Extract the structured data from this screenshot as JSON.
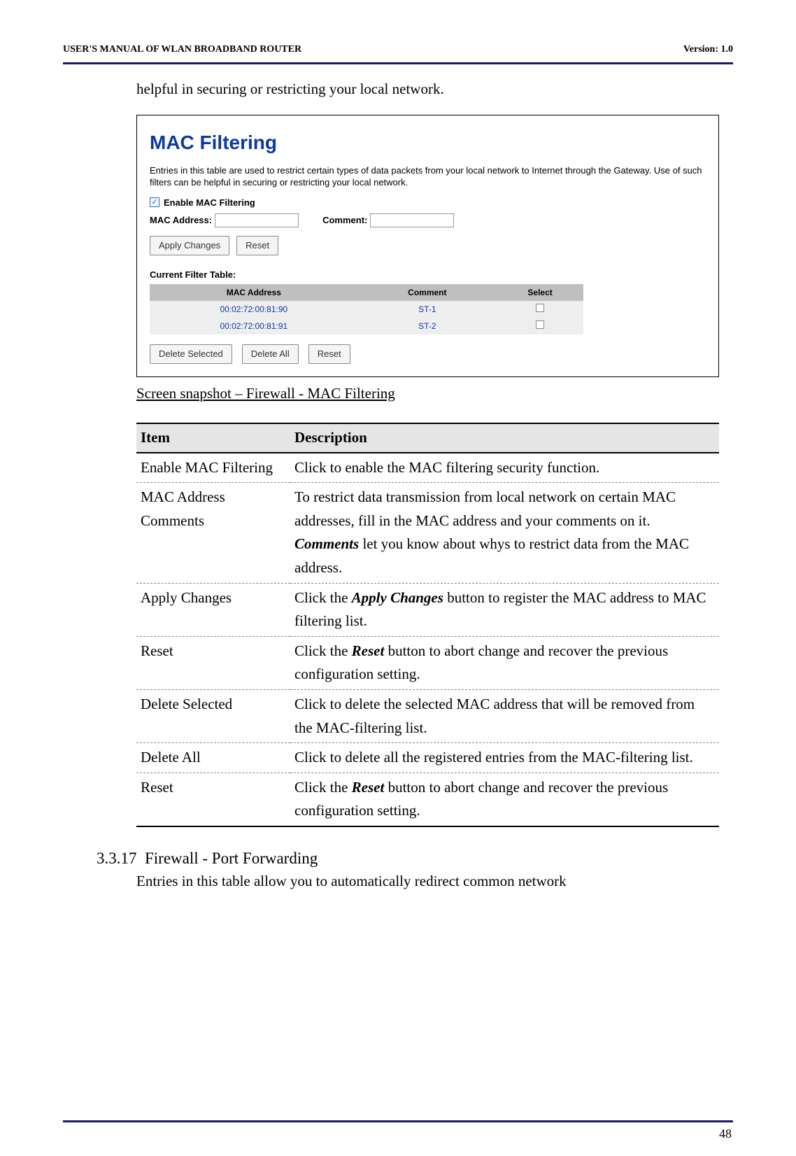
{
  "header": {
    "left": "USER'S MANUAL OF WLAN BROADBAND ROUTER",
    "right": "Version: 1.0"
  },
  "intro": "helpful in securing or restricting your local network.",
  "screenshot": {
    "title": "MAC Filtering",
    "desc": "Entries in this table are used to restrict certain types of data packets from your local network to Internet through the Gateway. Use of such filters can be helpful in securing or restricting your local network.",
    "enable_label": "Enable MAC Filtering",
    "mac_label": "MAC Address:",
    "comment_label": "Comment:",
    "apply_btn": "Apply Changes",
    "reset_btn": "Reset",
    "table_label": "Current Filter Table:",
    "th_mac": "MAC Address",
    "th_comment": "Comment",
    "th_select": "Select",
    "rows": [
      {
        "mac": "00:02:72:00:81:90",
        "comment": "ST-1"
      },
      {
        "mac": "00:02:72:00:81:91",
        "comment": "ST-2"
      }
    ],
    "del_sel_btn": "Delete Selected",
    "del_all_btn": "Delete All",
    "reset2_btn": "Reset"
  },
  "caption": "Screen snapshot – Firewall - MAC Filtering",
  "desc_table": {
    "h_item": "Item",
    "h_desc": "Description",
    "rows": {
      "r1_item": "Enable MAC Filtering",
      "r1_desc": "Click to enable the MAC filtering security function.",
      "r2_item": "MAC Address Comments",
      "r2_desc_a": "To restrict data transmission from local network on certain MAC addresses, fill in the MAC address and your comments on it.",
      "r2_desc_b1": "Comments",
      "r2_desc_b2": " let you know about whys to restrict data from the MAC address.",
      "r3_item": "Apply Changes",
      "r3_desc_a": "Click the ",
      "r3_desc_b": "Apply Changes",
      "r3_desc_c": " button to register the MAC address to MAC filtering list.",
      "r4_item": "Reset",
      "r4_desc_a": "Click the ",
      "r4_desc_b": "Reset",
      "r4_desc_c": " button to abort change and recover the previous configuration setting.",
      "r5_item": "Delete Selected",
      "r5_desc": "Click to delete the selected MAC address that will be removed from the MAC-filtering list.",
      "r6_item": "Delete All",
      "r6_desc": "Click to delete all the registered entries from the MAC-filtering list.",
      "r7_item": "Reset",
      "r7_desc_a": "Click the ",
      "r7_desc_b": "Reset",
      "r7_desc_c": " button to abort change and recover the previous configuration setting."
    }
  },
  "section": {
    "num": "3.3.17",
    "title": "Firewall - Port Forwarding",
    "body": "Entries in this table allow you to automatically redirect common network"
  },
  "page_num": "48"
}
